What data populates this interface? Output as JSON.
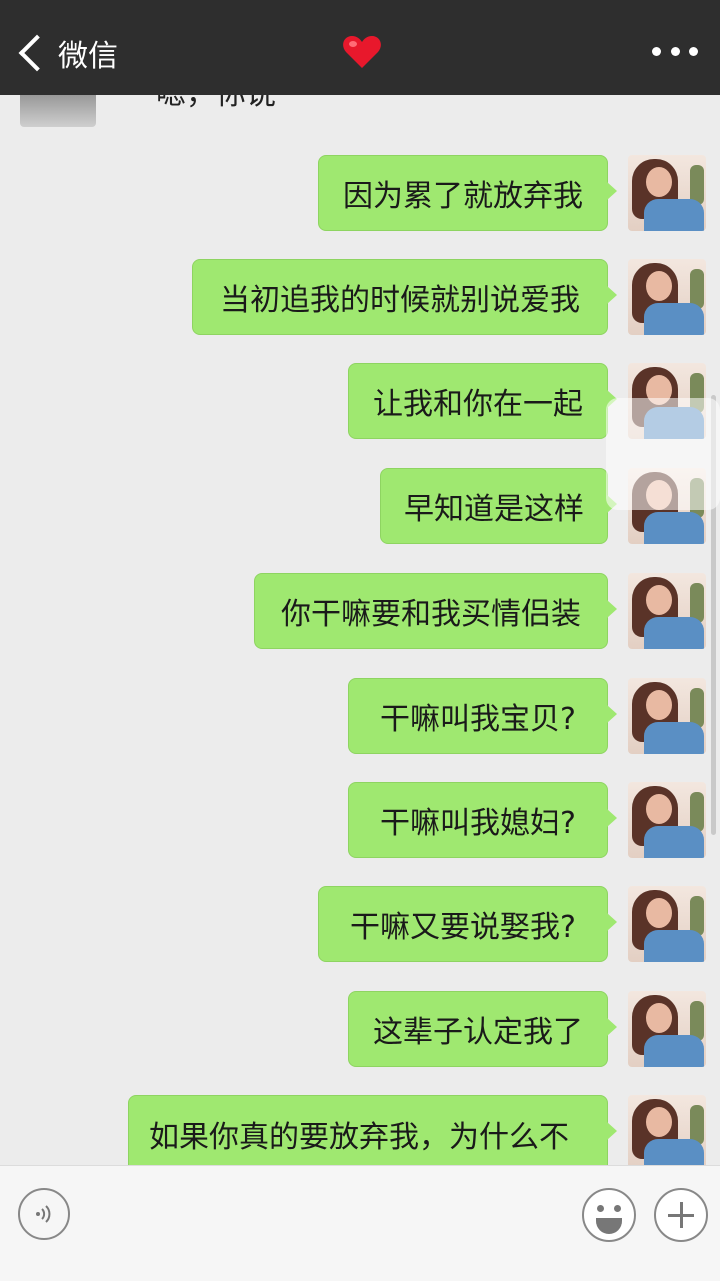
{
  "header": {
    "back_label": "微信",
    "title_icon": "red-heart-icon",
    "more_icon": "more-dots-icon"
  },
  "peer_message": {
    "text": "嗯，你说"
  },
  "messages": [
    "因为累了就放弃我",
    "当初追我的时候就别说爱我",
    "让我和你在一起",
    "早知道是这样",
    "你干嘛要和我买情侣装",
    "干嘛叫我宝贝?",
    "干嘛叫我媳妇?",
    "干嘛又要说娶我?",
    "这辈子认定我了",
    "如果你真的要放弃我，为什么不早说?"
  ],
  "input_bar": {
    "voice_icon": "voice-icon",
    "emoji_icon": "emoji-icon",
    "plus_icon": "plus-icon"
  },
  "colors": {
    "nav_bg": "#2e2e2e",
    "bubble_green": "#9fe870",
    "chat_bg": "#ececec"
  }
}
